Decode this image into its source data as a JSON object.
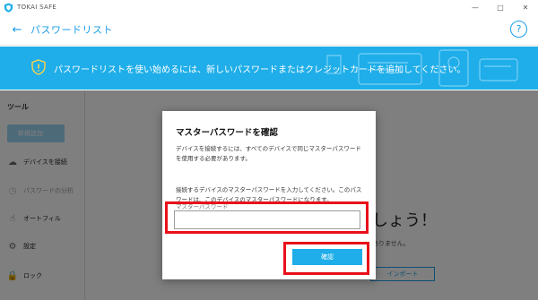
{
  "app": {
    "name": "TOKAI SAFE",
    "icon": "shield-logo-icon"
  },
  "window_controls": {
    "minimize": "—",
    "maximize": "□",
    "close": "✕"
  },
  "header": {
    "back_icon": "←",
    "title": "パスワードリスト",
    "help_icon": "?"
  },
  "banner": {
    "text": "パスワードリストを使い始めるには、新しいパスワードまたはクレジットカードを追加してください。",
    "color": "#1faee9"
  },
  "sidebar": {
    "section_title": "ツール",
    "new_button_label": "新規追加",
    "items": [
      {
        "label": "デバイスを接続",
        "icon": "cloud-sync-icon",
        "glyph": "☁"
      },
      {
        "label": "パスワードの分析",
        "icon": "clock-icon",
        "glyph": "◷"
      },
      {
        "label": "オートフィル",
        "icon": "hand-pointer-icon",
        "glyph": "☝"
      },
      {
        "label": "設定",
        "icon": "gear-icon",
        "glyph": "⚙"
      },
      {
        "label": "ロック",
        "icon": "lock-icon",
        "glyph": "🔒"
      }
    ]
  },
  "main": {
    "heading": "しょう！",
    "subtext": "ありません。",
    "import_label": "インポート"
  },
  "dialog": {
    "title": "マスターパスワードを確認",
    "description": "デバイスを接続するには、すべてのデバイスで同じマスターパスワードを使用する必要があります。",
    "info": "接続するデバイスのマスターパスワードを入力してください。このパスワードは、このデバイスのマスターパスワードになります。",
    "field_label": "マスターパスワード",
    "input_value": "",
    "confirm_label": "確認"
  },
  "colors": {
    "accent": "#1a9ee8",
    "highlight": "#e8101a"
  }
}
